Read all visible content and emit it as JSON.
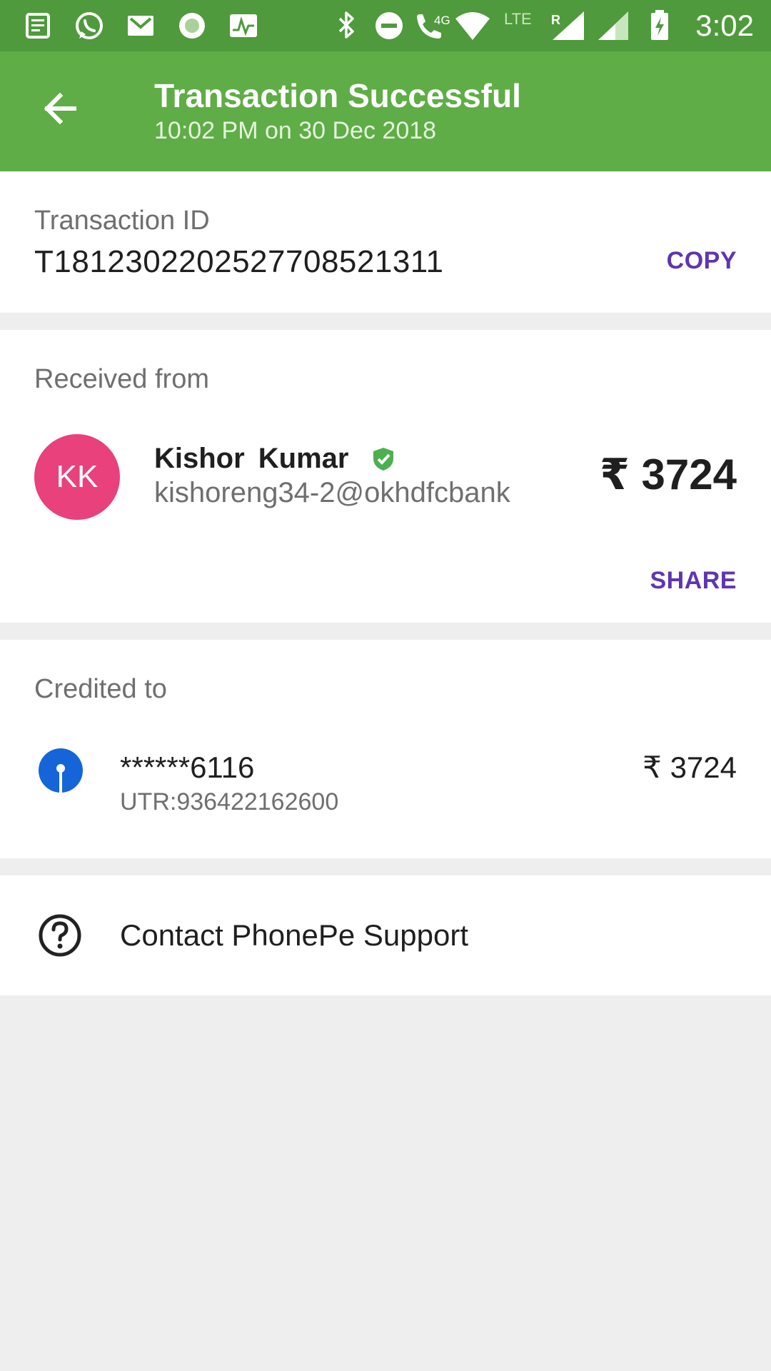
{
  "status_bar": {
    "time": "3:02",
    "network_label": "4G",
    "lte_label": "LTE",
    "roaming_label": "R",
    "icons": [
      "news-icon",
      "whatsapp-icon",
      "gmail-icon",
      "record-icon",
      "activity-icon",
      "bluetooth-icon",
      "do-not-disturb-icon",
      "volte-call-icon",
      "wifi-icon",
      "signal-icon",
      "signal-icon",
      "battery-charging-icon"
    ]
  },
  "header": {
    "title": "Transaction Successful",
    "subtitle": "10:02 PM on 30 Dec 2018",
    "back_icon": "arrow-back-icon"
  },
  "transaction": {
    "label": "Transaction ID",
    "id": "T1812302202527708521311",
    "copy_label": "COPY"
  },
  "received": {
    "label": "Received from",
    "avatar_initials": "KK",
    "avatar_color": "#e8417b",
    "name": "Kishor  Kumar",
    "verified_icon": "verified-shield-icon",
    "vpa": "kishoreng34-2@okhdfcbank",
    "amount": "₹ 3724",
    "share_label": "SHARE"
  },
  "credited": {
    "label": "Credited to",
    "bank_icon": "bank-logo-icon",
    "account": "******6116",
    "utr": "UTR:936422162600",
    "amount": "₹ 3724"
  },
  "support": {
    "icon": "help-circle-icon",
    "label": "Contact PhonePe Support"
  },
  "colors": {
    "status_bar": "#4f9a3c",
    "app_bar": "#5fad46",
    "accent": "#5f35b2",
    "verified": "#4caf50",
    "bank_logo": "#1565d8"
  }
}
